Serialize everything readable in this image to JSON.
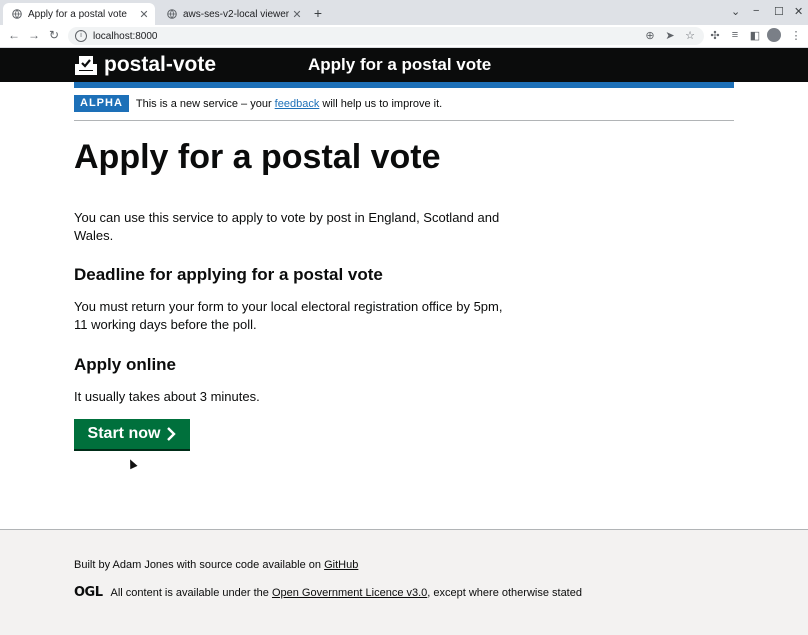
{
  "browser": {
    "tabs": [
      {
        "title": "Apply for a postal vote",
        "active": true
      },
      {
        "title": "aws-ses-v2-local viewer",
        "active": false
      }
    ],
    "new_tab": "+",
    "url": "localhost:8000",
    "window_controls": {
      "minimize": "−",
      "maximize": "☐",
      "close": "✕",
      "tab_search": "⌄"
    }
  },
  "header": {
    "logo_text": "postal-vote",
    "service_name": "Apply for a postal vote",
    "bg_color": "#0b0c0c",
    "accent_color": "#1d70b8"
  },
  "phase_banner": {
    "tag": "ALPHA",
    "text_before": "This is a new service – your ",
    "link": "feedback",
    "text_after": " will help us to improve it."
  },
  "main": {
    "title": "Apply for a postal vote",
    "intro": "You can use this service to apply to vote by post in England, Scotland and Wales.",
    "deadline_heading": "Deadline for applying for a postal vote",
    "deadline_text": "You must return your form to your local electoral registration office by 5pm, 11 working days before the poll.",
    "apply_heading": "Apply online",
    "apply_text": "It usually takes about 3 minutes.",
    "start_button": "Start now",
    "button_color": "#00703c"
  },
  "footer": {
    "built_by": "Built by Adam Jones with source code available on ",
    "github_link": "GitHub",
    "ogl_logo": "OGL",
    "licence_before": "All content is available under the ",
    "licence_link": "Open Government Licence v3.0",
    "licence_after": ", except where otherwise stated"
  }
}
